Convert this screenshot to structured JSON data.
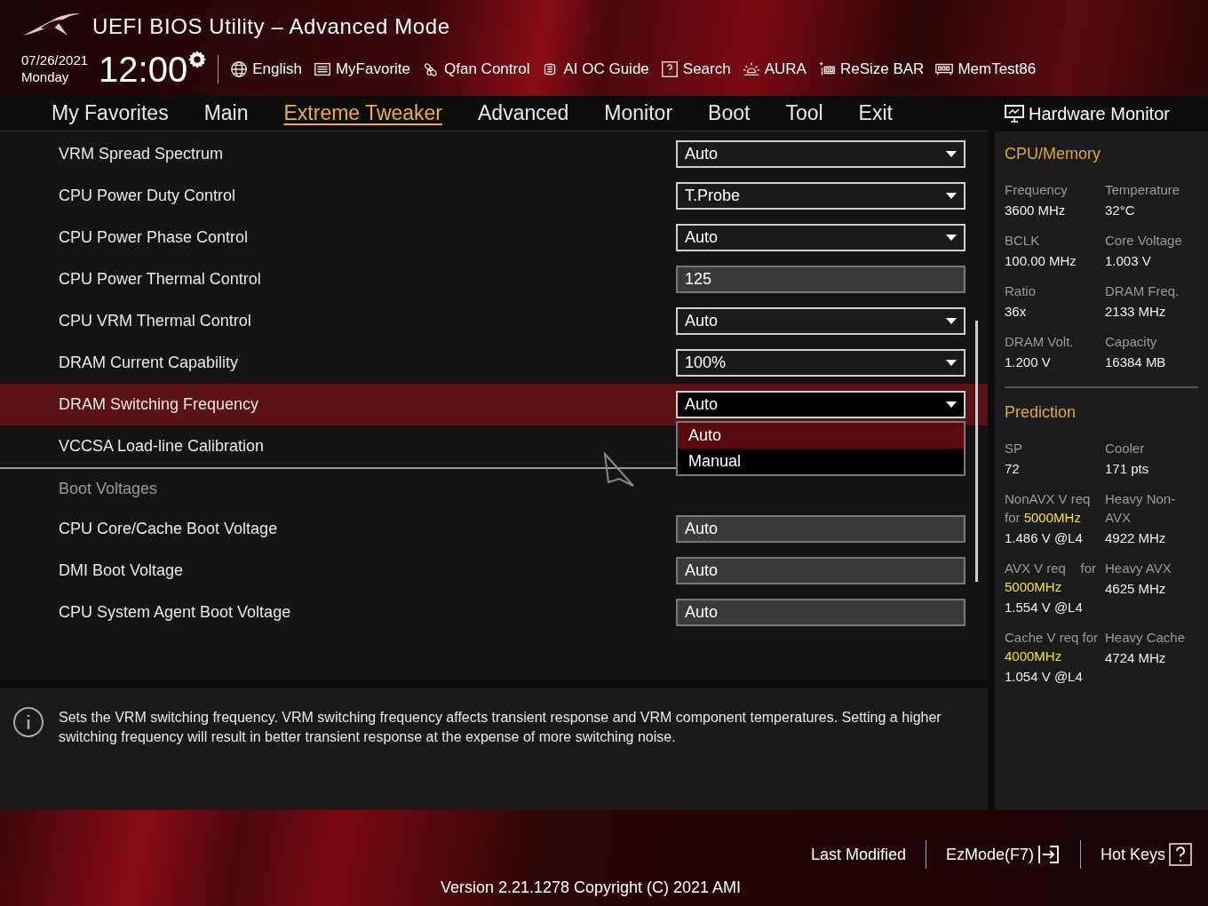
{
  "window": {
    "title": "UEFI BIOS Utility – Advanced Mode"
  },
  "clock": {
    "date": "07/26/2021",
    "day": "Monday",
    "time": "12:00"
  },
  "toolbar": [
    {
      "label": "English"
    },
    {
      "label": "MyFavorite"
    },
    {
      "label": "Qfan Control"
    },
    {
      "label": "AI OC Guide"
    },
    {
      "label": "Search"
    },
    {
      "label": "AURA"
    },
    {
      "label": "ReSize BAR"
    },
    {
      "label": "MemTest86"
    }
  ],
  "tabs": [
    {
      "label": "My Favorites",
      "selected": false
    },
    {
      "label": "Main",
      "selected": false
    },
    {
      "label": "Extreme Tweaker",
      "selected": true
    },
    {
      "label": "Advanced",
      "selected": false
    },
    {
      "label": "Monitor",
      "selected": false
    },
    {
      "label": "Boot",
      "selected": false
    },
    {
      "label": "Tool",
      "selected": false
    },
    {
      "label": "Exit",
      "selected": false
    }
  ],
  "settings": [
    {
      "kind": "dropdown",
      "label": "VRM Spread Spectrum",
      "value": "Auto",
      "selected": false
    },
    {
      "kind": "dropdown",
      "label": "CPU Power Duty Control",
      "value": "T.Probe",
      "selected": false
    },
    {
      "kind": "dropdown",
      "label": "CPU Power Phase Control",
      "value": "Auto",
      "selected": false
    },
    {
      "kind": "field",
      "label": "CPU Power Thermal Control",
      "value": "125",
      "selected": false
    },
    {
      "kind": "dropdown",
      "label": "CPU VRM Thermal Control",
      "value": "Auto",
      "selected": false
    },
    {
      "kind": "dropdown",
      "label": "DRAM Current Capability",
      "value": "100%",
      "selected": false
    },
    {
      "kind": "dropdown",
      "label": "DRAM Switching Frequency",
      "value": "Auto",
      "selected": true,
      "expanded": true,
      "options": [
        {
          "label": "Auto",
          "selected": true
        },
        {
          "label": "Manual",
          "selected": false
        }
      ]
    },
    {
      "kind": "plain",
      "label": "VCCSA Load-line Calibration",
      "selected": false
    },
    {
      "kind": "divider"
    },
    {
      "kind": "section",
      "label": "Boot Voltages"
    },
    {
      "kind": "field",
      "label": "CPU Core/Cache Boot Voltage",
      "value": "Auto",
      "selected": false
    },
    {
      "kind": "field",
      "label": "DMI Boot Voltage",
      "value": "Auto",
      "selected": false
    },
    {
      "kind": "field",
      "label": "CPU System Agent Boot Voltage",
      "value": "Auto",
      "selected": false
    }
  ],
  "help": "Sets the VRM switching frequency.  VRM switching frequency affects transient response and VRM component temperatures. Setting a higher switching frequency will result in better transient response at the expense of more switching noise.",
  "hardware_monitor": {
    "title": "Hardware Monitor",
    "sections": [
      {
        "title": "CPU/Memory",
        "items": [
          {
            "label": "Frequency",
            "value": "3600 MHz"
          },
          {
            "label": "Temperature",
            "value": "32°C"
          },
          {
            "label": "BCLK",
            "value": "100.00 MHz"
          },
          {
            "label": "Core Voltage",
            "value": "1.003 V"
          },
          {
            "label": "Ratio",
            "value": "36x"
          },
          {
            "label": "DRAM Freq.",
            "value": "2133 MHz"
          },
          {
            "label": "DRAM Volt.",
            "value": "1.200 V"
          },
          {
            "label": "Capacity",
            "value": "16384 MB"
          }
        ]
      },
      {
        "title": "Prediction",
        "items": [
          {
            "label": "SP",
            "value": "72"
          },
          {
            "label": "Cooler",
            "value": "171 pts"
          },
          {
            "label": "NonAVX V req for",
            "highlight": "5000MHz",
            "value": "1.486 V @L4"
          },
          {
            "label": "Heavy Non-AVX",
            "value": "4922 MHz"
          },
          {
            "label": "AVX V req    for",
            "highlight": "5000MHz",
            "value": "1.554 V @L4"
          },
          {
            "label": "Heavy AVX",
            "value": "4625 MHz"
          },
          {
            "label": "Cache V req for",
            "highlight": "4000MHz",
            "value": "1.054 V @L4"
          },
          {
            "label": "Heavy Cache",
            "value": "4724 MHz"
          }
        ]
      }
    ]
  },
  "footer": {
    "buttons": [
      "Last Modified",
      "EzMode(F7)",
      "Hot Keys"
    ],
    "version": "Version 2.21.1278 Copyright (C) 2021 AMI"
  }
}
